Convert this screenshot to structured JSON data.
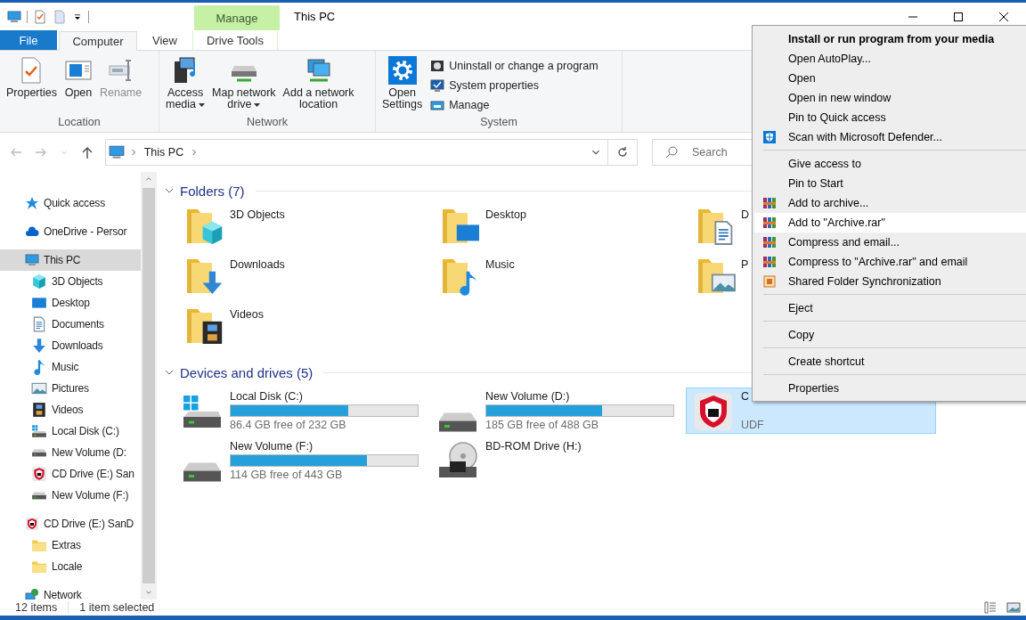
{
  "titlebar": {
    "contextual_header": "Manage",
    "title": "This PC"
  },
  "ribbon": {
    "tabs": [
      {
        "label": "File",
        "kind": "file",
        "selected": false
      },
      {
        "label": "Computer",
        "kind": "tab",
        "selected": true
      },
      {
        "label": "View",
        "kind": "tab",
        "selected": false
      },
      {
        "label": "Drive Tools",
        "kind": "contextual",
        "selected": false
      }
    ],
    "groups": [
      {
        "label": "Location",
        "buttons": [
          {
            "label": "Properties",
            "kind": "properties",
            "disabled": false,
            "dropdown": false
          },
          {
            "label": "Open",
            "kind": "open",
            "disabled": false,
            "dropdown": false
          },
          {
            "label": "Rename",
            "kind": "rename",
            "disabled": true,
            "dropdown": false
          }
        ]
      },
      {
        "label": "Network",
        "buttons": [
          {
            "label": "Access\nmedia",
            "kind": "media",
            "disabled": false,
            "dropdown": true
          },
          {
            "label": "Map network\ndrive",
            "kind": "mapdrive",
            "disabled": false,
            "dropdown": true
          },
          {
            "label": "Add a network\nlocation",
            "kind": "netloc",
            "disabled": false,
            "dropdown": false
          }
        ]
      },
      {
        "label": "System",
        "buttons": [
          {
            "label": "Open\nSettings",
            "kind": "settings",
            "disabled": false,
            "dropdown": false
          }
        ],
        "small_buttons": [
          {
            "label": "Uninstall or change a program",
            "kind": "uninstall"
          },
          {
            "label": "System properties",
            "kind": "sysprops"
          },
          {
            "label": "Manage",
            "kind": "manage"
          }
        ]
      }
    ]
  },
  "address_bar": {
    "path": [
      "This PC"
    ]
  },
  "search": {
    "placeholder": "Search"
  },
  "navigation_pane": {
    "items": [
      {
        "label": "Quick access",
        "kind": "star",
        "selected": false
      },
      {
        "label": "OneDrive - Persor",
        "kind": "cloud",
        "selected": false
      },
      {
        "label": "This PC",
        "kind": "monitor",
        "selected": true,
        "children": [
          {
            "label": "3D Objects",
            "kind": "cube",
            "selected": false
          },
          {
            "label": "Desktop",
            "kind": "desktop",
            "selected": false
          },
          {
            "label": "Documents",
            "kind": "document",
            "selected": false
          },
          {
            "label": "Downloads",
            "kind": "downloads",
            "selected": false
          },
          {
            "label": "Music",
            "kind": "music",
            "selected": false
          },
          {
            "label": "Pictures",
            "kind": "pictures",
            "selected": false
          },
          {
            "label": "Videos",
            "kind": "videos",
            "selected": false
          },
          {
            "label": "Local Disk (C:)",
            "kind": "windisk",
            "selected": false
          },
          {
            "label": "New Volume (D:",
            "kind": "hdd",
            "selected": false
          },
          {
            "label": "CD Drive (E:) San",
            "kind": "shield",
            "selected": false
          },
          {
            "label": "New Volume (F:)",
            "kind": "hdd",
            "selected": false
          }
        ]
      },
      {
        "label": "CD Drive (E:) SanD",
        "kind": "shield",
        "selected": false,
        "children": [
          {
            "label": "Extras",
            "kind": "folder",
            "selected": false
          },
          {
            "label": "Locale",
            "kind": "folder",
            "selected": false
          }
        ]
      },
      {
        "label": "Network",
        "kind": "network",
        "selected": false
      }
    ]
  },
  "folders": {
    "title": "Folders (7)",
    "expanded": true,
    "items": [
      {
        "name": "3D Objects",
        "kind": "cube"
      },
      {
        "name": "Desktop",
        "kind": "desktop"
      },
      {
        "name": "D",
        "kind": "document"
      },
      {
        "name": "Downloads",
        "kind": "downloads"
      },
      {
        "name": "Music",
        "kind": "music"
      },
      {
        "name": "P",
        "kind": "pictures"
      },
      {
        "name": "Videos",
        "kind": "videos"
      }
    ]
  },
  "drives": {
    "title": "Devices and drives (5)",
    "expanded": true,
    "items": [
      {
        "name": "Local Disk (C:)",
        "kind": "windisk",
        "level": 0.63,
        "free": "86.4 GB free of 232 GB",
        "selected": false
      },
      {
        "name": "New Volume (D:)",
        "kind": "hdd",
        "level": 0.62,
        "free": "185 GB free of 488 GB",
        "selected": false
      },
      {
        "name": "C",
        "kind": "shield",
        "file_system": "UDF",
        "selected": true
      },
      {
        "name": "New Volume (F:)",
        "kind": "hdd",
        "level": 0.73,
        "free": "114 GB free of 443 GB",
        "selected": false
      },
      {
        "name": "BD-ROM Drive (H:)",
        "kind": "bd",
        "selected": false
      }
    ]
  },
  "context_menu": {
    "items": [
      {
        "kind": "item",
        "label": "Install or run program from your media",
        "default": true,
        "highlighted": false
      },
      {
        "kind": "item",
        "label": "Open AutoPlay...",
        "default": false,
        "highlighted": false
      },
      {
        "kind": "item",
        "label": "Open",
        "default": false,
        "highlighted": false
      },
      {
        "kind": "item",
        "label": "Open in new window",
        "default": false,
        "highlighted": false
      },
      {
        "kind": "item",
        "label": "Pin to Quick access",
        "default": false,
        "highlighted": false
      },
      {
        "kind": "defender",
        "label": "Scan with Microsoft Defender...",
        "default": false,
        "highlighted": false
      },
      {
        "kind": "separator"
      },
      {
        "kind": "item",
        "label": "Give access to",
        "default": false,
        "highlighted": false
      },
      {
        "kind": "item",
        "label": "Pin to Start",
        "default": false,
        "highlighted": false
      },
      {
        "kind": "rar",
        "label": "Add to archive...",
        "default": false,
        "highlighted": false
      },
      {
        "kind": "rar",
        "label": "Add to \"Archive.rar\"",
        "default": false,
        "highlighted": true
      },
      {
        "kind": "rar",
        "label": "Compress and email...",
        "default": false,
        "highlighted": false
      },
      {
        "kind": "rar",
        "label": "Compress to \"Archive.rar\" and email",
        "default": false,
        "highlighted": false
      },
      {
        "kind": "sync",
        "label": "Shared Folder Synchronization",
        "default": false,
        "highlighted": false
      },
      {
        "kind": "separator"
      },
      {
        "kind": "item",
        "label": "Eject",
        "default": false,
        "highlighted": false
      },
      {
        "kind": "separator"
      },
      {
        "kind": "item",
        "label": "Copy",
        "default": false,
        "highlighted": false
      },
      {
        "kind": "separator"
      },
      {
        "kind": "item",
        "label": "Create shortcut",
        "default": false,
        "highlighted": false
      },
      {
        "kind": "separator"
      },
      {
        "kind": "item",
        "label": "Properties",
        "default": false,
        "highlighted": false
      }
    ]
  },
  "status_bar": {
    "item_count": "12 items",
    "selection": "1 item selected"
  }
}
